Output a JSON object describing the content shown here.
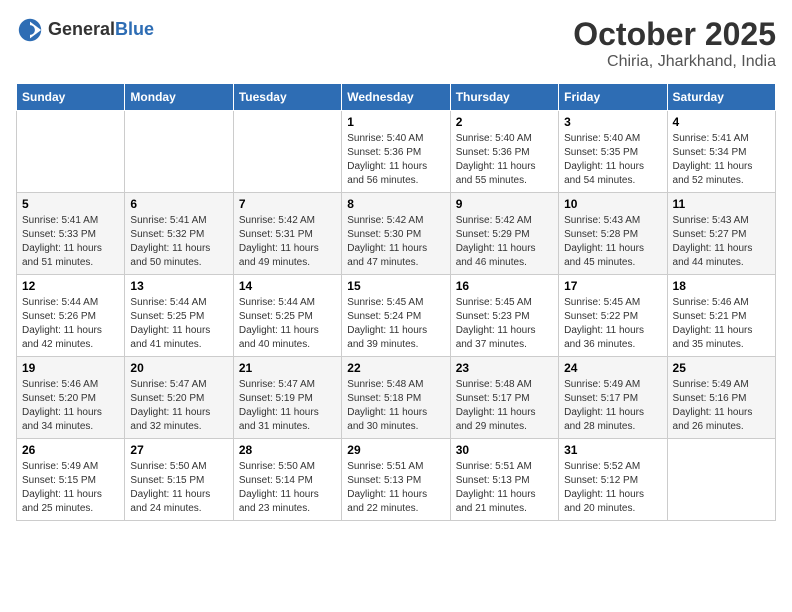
{
  "header": {
    "logo_general": "General",
    "logo_blue": "Blue",
    "month": "October 2025",
    "location": "Chiria, Jharkhand, India"
  },
  "weekdays": [
    "Sunday",
    "Monday",
    "Tuesday",
    "Wednesday",
    "Thursday",
    "Friday",
    "Saturday"
  ],
  "weeks": [
    [
      {
        "day": "",
        "info": ""
      },
      {
        "day": "",
        "info": ""
      },
      {
        "day": "",
        "info": ""
      },
      {
        "day": "1",
        "info": "Sunrise: 5:40 AM\nSunset: 5:36 PM\nDaylight: 11 hours\nand 56 minutes."
      },
      {
        "day": "2",
        "info": "Sunrise: 5:40 AM\nSunset: 5:36 PM\nDaylight: 11 hours\nand 55 minutes."
      },
      {
        "day": "3",
        "info": "Sunrise: 5:40 AM\nSunset: 5:35 PM\nDaylight: 11 hours\nand 54 minutes."
      },
      {
        "day": "4",
        "info": "Sunrise: 5:41 AM\nSunset: 5:34 PM\nDaylight: 11 hours\nand 52 minutes."
      }
    ],
    [
      {
        "day": "5",
        "info": "Sunrise: 5:41 AM\nSunset: 5:33 PM\nDaylight: 11 hours\nand 51 minutes."
      },
      {
        "day": "6",
        "info": "Sunrise: 5:41 AM\nSunset: 5:32 PM\nDaylight: 11 hours\nand 50 minutes."
      },
      {
        "day": "7",
        "info": "Sunrise: 5:42 AM\nSunset: 5:31 PM\nDaylight: 11 hours\nand 49 minutes."
      },
      {
        "day": "8",
        "info": "Sunrise: 5:42 AM\nSunset: 5:30 PM\nDaylight: 11 hours\nand 47 minutes."
      },
      {
        "day": "9",
        "info": "Sunrise: 5:42 AM\nSunset: 5:29 PM\nDaylight: 11 hours\nand 46 minutes."
      },
      {
        "day": "10",
        "info": "Sunrise: 5:43 AM\nSunset: 5:28 PM\nDaylight: 11 hours\nand 45 minutes."
      },
      {
        "day": "11",
        "info": "Sunrise: 5:43 AM\nSunset: 5:27 PM\nDaylight: 11 hours\nand 44 minutes."
      }
    ],
    [
      {
        "day": "12",
        "info": "Sunrise: 5:44 AM\nSunset: 5:26 PM\nDaylight: 11 hours\nand 42 minutes."
      },
      {
        "day": "13",
        "info": "Sunrise: 5:44 AM\nSunset: 5:25 PM\nDaylight: 11 hours\nand 41 minutes."
      },
      {
        "day": "14",
        "info": "Sunrise: 5:44 AM\nSunset: 5:25 PM\nDaylight: 11 hours\nand 40 minutes."
      },
      {
        "day": "15",
        "info": "Sunrise: 5:45 AM\nSunset: 5:24 PM\nDaylight: 11 hours\nand 39 minutes."
      },
      {
        "day": "16",
        "info": "Sunrise: 5:45 AM\nSunset: 5:23 PM\nDaylight: 11 hours\nand 37 minutes."
      },
      {
        "day": "17",
        "info": "Sunrise: 5:45 AM\nSunset: 5:22 PM\nDaylight: 11 hours\nand 36 minutes."
      },
      {
        "day": "18",
        "info": "Sunrise: 5:46 AM\nSunset: 5:21 PM\nDaylight: 11 hours\nand 35 minutes."
      }
    ],
    [
      {
        "day": "19",
        "info": "Sunrise: 5:46 AM\nSunset: 5:20 PM\nDaylight: 11 hours\nand 34 minutes."
      },
      {
        "day": "20",
        "info": "Sunrise: 5:47 AM\nSunset: 5:20 PM\nDaylight: 11 hours\nand 32 minutes."
      },
      {
        "day": "21",
        "info": "Sunrise: 5:47 AM\nSunset: 5:19 PM\nDaylight: 11 hours\nand 31 minutes."
      },
      {
        "day": "22",
        "info": "Sunrise: 5:48 AM\nSunset: 5:18 PM\nDaylight: 11 hours\nand 30 minutes."
      },
      {
        "day": "23",
        "info": "Sunrise: 5:48 AM\nSunset: 5:17 PM\nDaylight: 11 hours\nand 29 minutes."
      },
      {
        "day": "24",
        "info": "Sunrise: 5:49 AM\nSunset: 5:17 PM\nDaylight: 11 hours\nand 28 minutes."
      },
      {
        "day": "25",
        "info": "Sunrise: 5:49 AM\nSunset: 5:16 PM\nDaylight: 11 hours\nand 26 minutes."
      }
    ],
    [
      {
        "day": "26",
        "info": "Sunrise: 5:49 AM\nSunset: 5:15 PM\nDaylight: 11 hours\nand 25 minutes."
      },
      {
        "day": "27",
        "info": "Sunrise: 5:50 AM\nSunset: 5:15 PM\nDaylight: 11 hours\nand 24 minutes."
      },
      {
        "day": "28",
        "info": "Sunrise: 5:50 AM\nSunset: 5:14 PM\nDaylight: 11 hours\nand 23 minutes."
      },
      {
        "day": "29",
        "info": "Sunrise: 5:51 AM\nSunset: 5:13 PM\nDaylight: 11 hours\nand 22 minutes."
      },
      {
        "day": "30",
        "info": "Sunrise: 5:51 AM\nSunset: 5:13 PM\nDaylight: 11 hours\nand 21 minutes."
      },
      {
        "day": "31",
        "info": "Sunrise: 5:52 AM\nSunset: 5:12 PM\nDaylight: 11 hours\nand 20 minutes."
      },
      {
        "day": "",
        "info": ""
      }
    ]
  ]
}
